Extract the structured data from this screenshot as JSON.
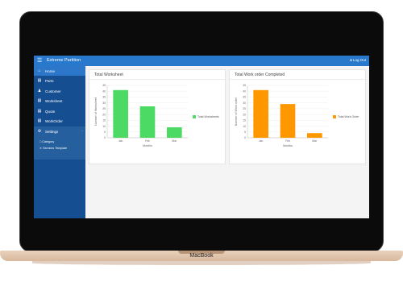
{
  "device": {
    "brand": "MacBook"
  },
  "header": {
    "title": "Extreme Partition",
    "logout_label": "Log Out"
  },
  "sidebar": {
    "items": [
      {
        "label": "Home",
        "icon": "home-icon"
      },
      {
        "label": "Parts",
        "icon": "list-icon"
      },
      {
        "label": "Customer",
        "icon": "user-icon"
      },
      {
        "label": "Worksheet",
        "icon": "document-icon"
      },
      {
        "label": "Quote",
        "icon": "document-icon"
      },
      {
        "label": "WorkOrder",
        "icon": "document-icon"
      },
      {
        "label": "Settings",
        "icon": "gear-icon"
      }
    ],
    "sub_items": [
      {
        "label": "Category",
        "icon": "folder-icon"
      },
      {
        "label": "Services Template",
        "icon": "tools-icon"
      }
    ]
  },
  "worksheet_card": {
    "title": "Total Worksheet"
  },
  "workorder_card": {
    "title": "Total Work order Completed"
  },
  "colors": {
    "header": "#2878cc",
    "sidebar": "#164f91",
    "worksheet_bar": "#4cd964",
    "workorder_bar": "#ff9800"
  },
  "chart_data": [
    {
      "type": "bar",
      "categories": [
        "Jan",
        "Feb",
        "Mar"
      ],
      "series": [
        {
          "name": "Total Worksheets",
          "values": [
            41,
            27,
            9
          ]
        }
      ],
      "xlabel": "Months",
      "ylabel": "Number of Worksheet",
      "ylim": [
        0,
        45
      ],
      "yticks": [
        0,
        5,
        10,
        15,
        20,
        25,
        30,
        35,
        40,
        45
      ],
      "grid": true,
      "legend": "right"
    },
    {
      "type": "bar",
      "categories": [
        "Jan",
        "Feb",
        "Mar"
      ],
      "series": [
        {
          "name": "Total Work Order",
          "values": [
            41,
            29,
            4
          ]
        }
      ],
      "xlabel": "Months",
      "ylabel": "Number of Work order",
      "ylim": [
        0,
        45
      ],
      "yticks": [
        0,
        5,
        10,
        15,
        20,
        25,
        30,
        35,
        40,
        45
      ],
      "grid": true,
      "legend": "right"
    }
  ]
}
